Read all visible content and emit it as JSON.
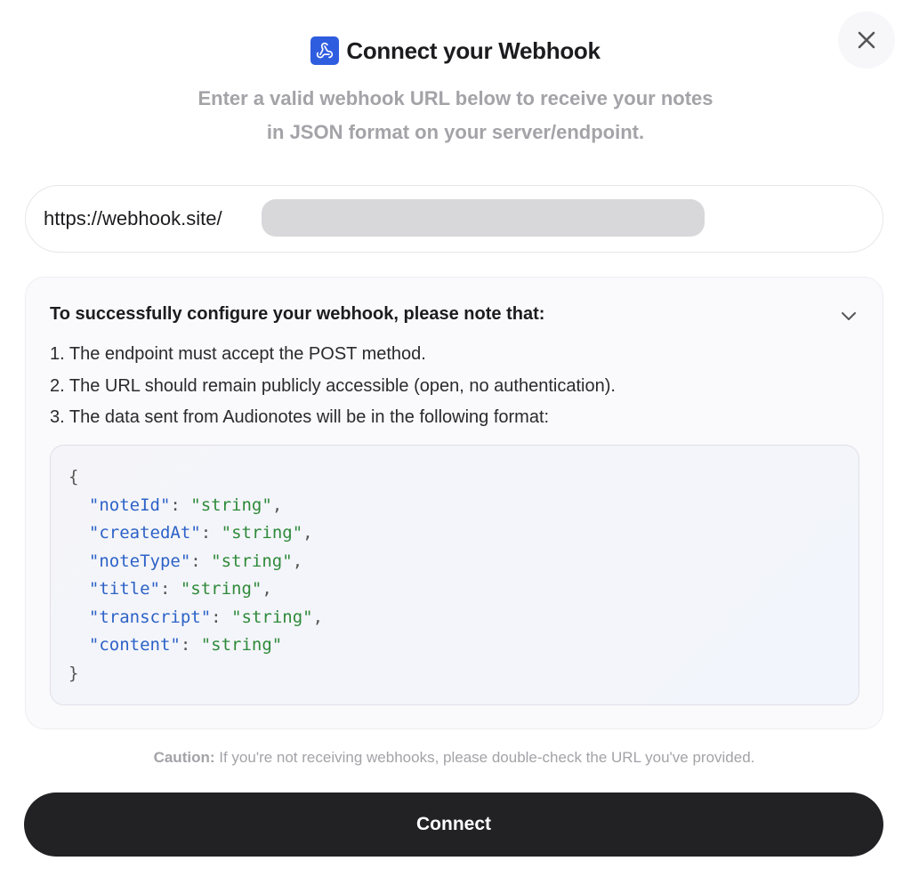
{
  "modal": {
    "title": "Connect your Webhook",
    "subtitle": "Enter a valid webhook URL below to receive your notes in JSON format on your server/endpoint.",
    "url_input": {
      "value": "https://webhook.site/"
    },
    "info": {
      "heading": "To successfully configure your webhook, please note that:",
      "items": [
        "1. The endpoint must accept the POST method.",
        "2. The URL should remain publicly accessible (open, no authentication).",
        "3. The data sent from Audionotes will be in the following format:"
      ],
      "code": {
        "open": "{",
        "close": "}",
        "fields": [
          {
            "key": "\"noteId\"",
            "value": "\"string\"",
            "sep": ","
          },
          {
            "key": "\"createdAt\"",
            "value": "\"string\"",
            "sep": ","
          },
          {
            "key": "\"noteType\"",
            "value": "\"string\"",
            "sep": ","
          },
          {
            "key": "\"title\"",
            "value": "\"string\"",
            "sep": ","
          },
          {
            "key": "\"transcript\"",
            "value": "\"string\"",
            "sep": ","
          },
          {
            "key": "\"content\"",
            "value": "\"string\"",
            "sep": ""
          }
        ]
      }
    },
    "caution": {
      "label": "Caution:",
      "text": " If you're not receiving webhooks, please double-check the URL you've provided."
    },
    "connect_label": "Connect",
    "icons": {
      "logo": "webhook-icon",
      "close": "close-icon",
      "chevron": "chevron-down-icon"
    }
  }
}
